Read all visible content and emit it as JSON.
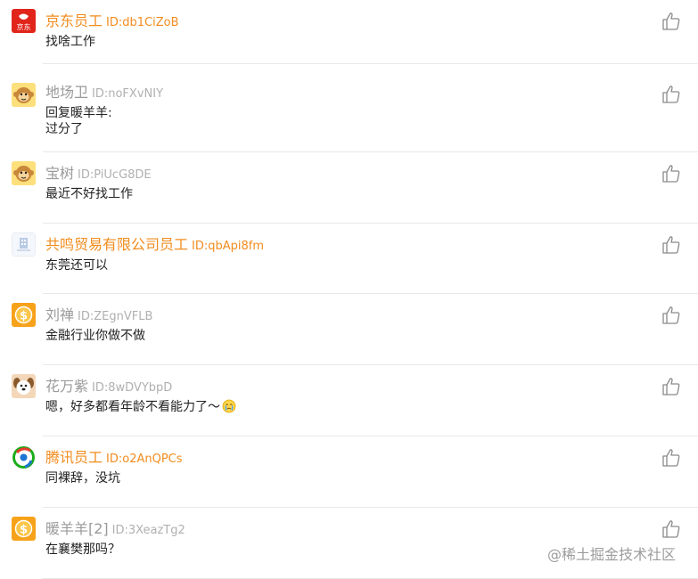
{
  "comments": [
    {
      "name": "京东员工",
      "id": "ID:db1CiZoB",
      "text_lines": [
        "找啥工作"
      ],
      "verified": true,
      "avatar": "jd-logo",
      "avatar_text": "京东"
    },
    {
      "name": "地场卫",
      "id": "ID:noFXvNIY",
      "text_lines": [
        "回复暖羊羊:",
        "过分了"
      ],
      "verified": false,
      "avatar": "monkey-avatar"
    },
    {
      "name": "宝树",
      "id": "ID:PiUcG8DE",
      "text_lines": [
        "最近不好找工作"
      ],
      "verified": false,
      "avatar": "monkey-avatar"
    },
    {
      "name": "共鸣贸易有限公司员工",
      "id": "ID:qbApi8fm",
      "text_lines": [
        "东莞还可以"
      ],
      "verified": true,
      "avatar": "company-avatar"
    },
    {
      "name": "刘禅",
      "id": "ID:ZEgnVFLB",
      "text_lines": [
        "金融行业你做不做"
      ],
      "verified": false,
      "avatar": "coin-avatar"
    },
    {
      "name": "花万紫",
      "id": "ID:8wDVYbpD",
      "text_lines": [
        "嗯，好多都看年龄不看能力了～"
      ],
      "verified": false,
      "avatar": "dog-avatar",
      "emoji": "crying-emoji"
    },
    {
      "name": "腾讯员工",
      "id": "ID:o2AnQPCs",
      "text_lines": [
        "同裸辞，没坑"
      ],
      "verified": true,
      "avatar": "tencent-logo"
    },
    {
      "name": "暖羊羊[2]",
      "id": "ID:3XeazTg2",
      "text_lines": [
        "在襄樊那吗？"
      ],
      "verified": false,
      "avatar": "coin-avatar"
    }
  ],
  "watermark": "@稀土掘金技术社区",
  "colors": {
    "verified_name": "#f28c1e",
    "plain_name": "#9a9a9a",
    "divider": "#e8e8e8"
  }
}
